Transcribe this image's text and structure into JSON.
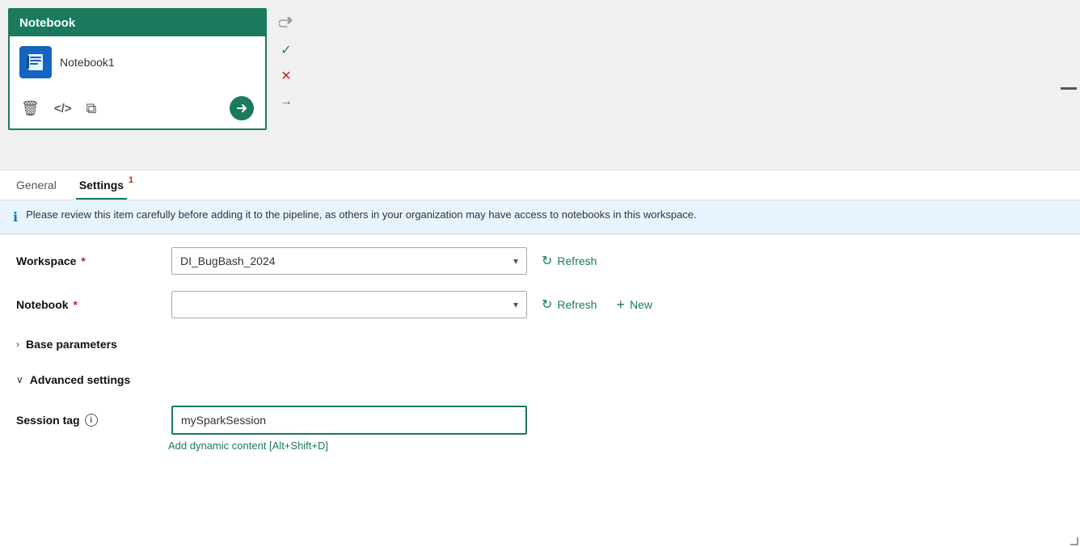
{
  "notebook_card": {
    "header": "Notebook",
    "notebook_name": "Notebook1",
    "icons": {
      "delete": "🗑",
      "code": "</>",
      "copy": "⧉",
      "go": "→"
    }
  },
  "tabs": {
    "general_label": "General",
    "settings_label": "Settings",
    "settings_badge": "1"
  },
  "info_banner": {
    "text": "Please review this item carefully before adding it to the pipeline, as others in your organization may have access to notebooks in this workspace."
  },
  "workspace_field": {
    "label": "Workspace",
    "value": "DI_BugBash_2024",
    "refresh_label": "Refresh"
  },
  "notebook_field": {
    "label": "Notebook",
    "value": "",
    "refresh_label": "Refresh",
    "new_label": "New"
  },
  "base_parameters": {
    "label": "Base parameters",
    "collapsed": true
  },
  "advanced_settings": {
    "label": "Advanced settings",
    "expanded": true
  },
  "session_tag": {
    "label": "Session tag",
    "value": "mySparkSession",
    "dynamic_link": "Add dynamic content [Alt+Shift+D]"
  }
}
